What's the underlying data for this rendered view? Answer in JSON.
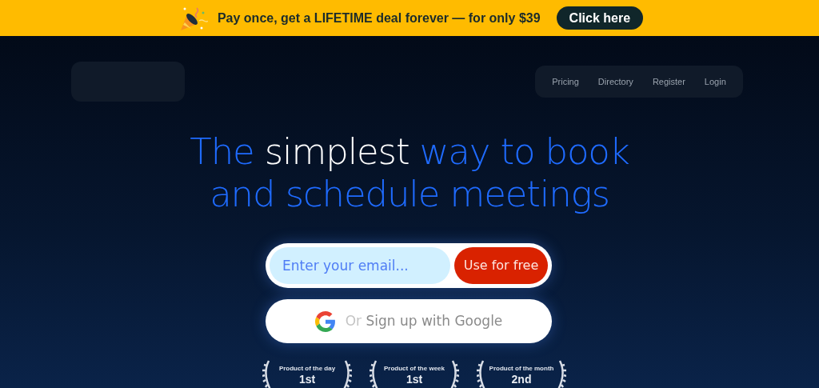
{
  "banner": {
    "text": "Pay once, get a LIFETIME deal forever — for only $39",
    "button": "Click here"
  },
  "nav": {
    "links": [
      "Pricing",
      "Directory",
      "Register",
      "Login"
    ]
  },
  "headline": {
    "lines": [
      [
        {
          "text": "The ",
          "highlight": false
        },
        {
          "text": "simplest",
          "highlight": true
        },
        {
          "text": " way to book",
          "highlight": false
        }
      ],
      [
        {
          "text": "and schedule meetings",
          "highlight": false
        }
      ]
    ]
  },
  "signup": {
    "email_placeholder": "Enter your email...",
    "submit": "Use for free",
    "google_prefix": "Or",
    "google_label": "Sign up with Google"
  },
  "awards": [
    {
      "title": "Product of the day",
      "rank": "1st"
    },
    {
      "title": "Product of the week",
      "rank": "1st"
    },
    {
      "title": "Product of the month",
      "rank": "2nd"
    }
  ]
}
